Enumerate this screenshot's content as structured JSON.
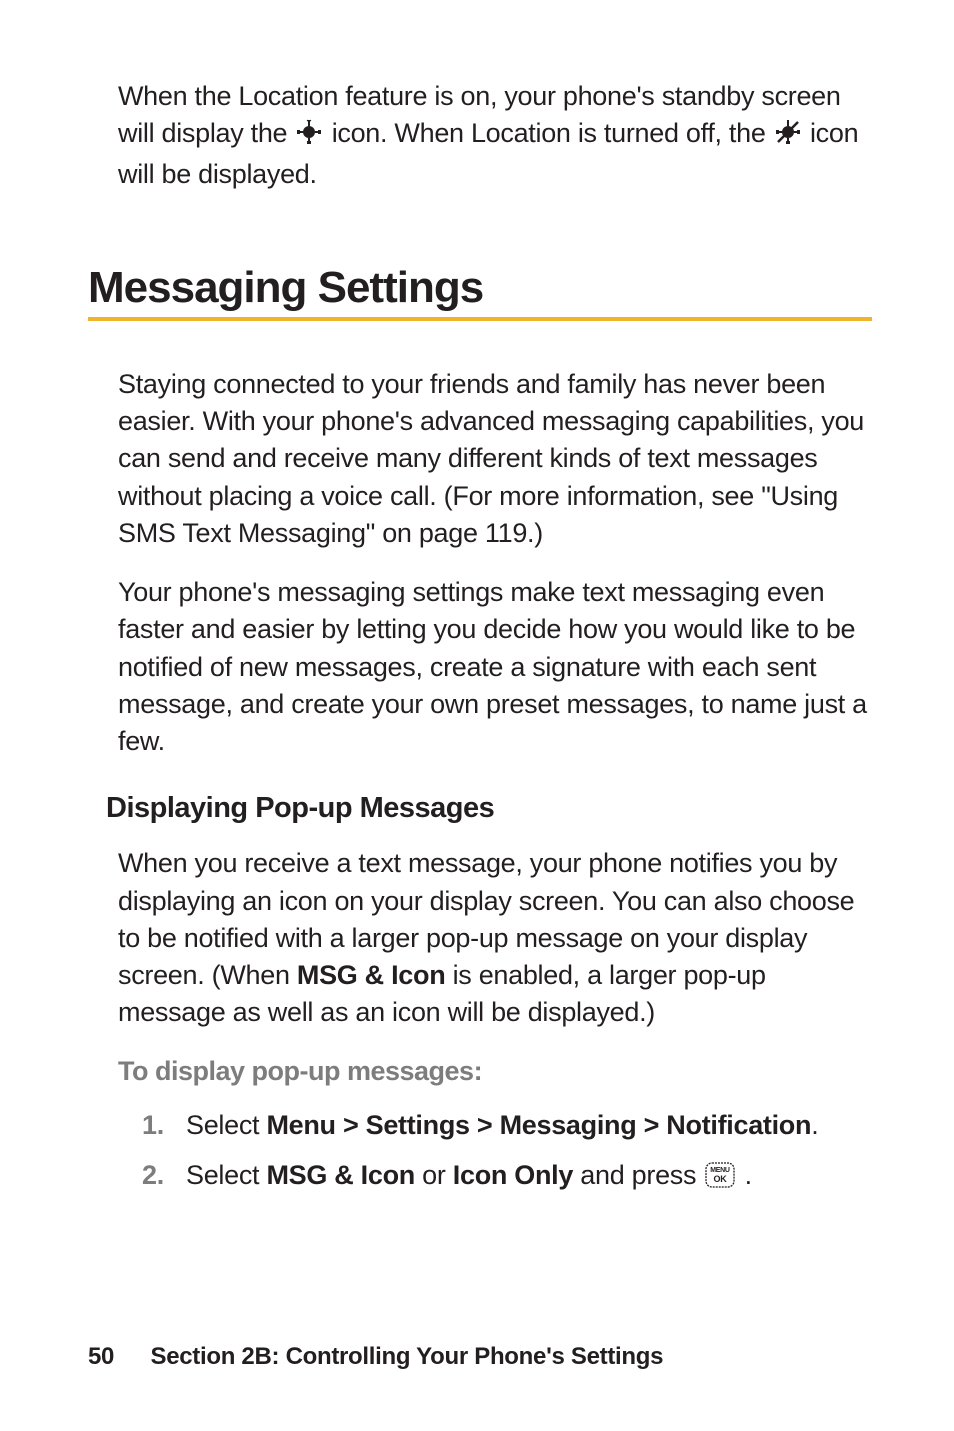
{
  "intro": {
    "part1": "When the Location feature is on, your phone's standby screen will display the ",
    "part2": " icon. When Location is turned off, the ",
    "part3": " icon will be displayed."
  },
  "section_heading": "Messaging Settings",
  "para1": "Staying connected to your friends and family has never been easier. With your phone's advanced messaging capabilities, you can send and receive many different kinds of text messages without placing a voice call. (For more information, see \"Using SMS Text Messaging\" on page 119.)",
  "para2": "Your phone's messaging settings make text messaging even faster and easier by letting you decide how you would like to be notified of new messages, create a signature with each sent message, and create your own preset messages, to name just a few.",
  "sub1_heading": "Displaying Pop-up Messages",
  "sub1_para": {
    "t1": "When you receive a text message, your phone notifies you by displaying an icon on your display screen. You can also choose to be notified with a larger pop-up message on your display screen. (When ",
    "b1": "MSG & Icon",
    "t2": " is enabled, a larger pop-up message as well as an icon will be displayed.)"
  },
  "action_label": "To display pop-up messages:",
  "steps": {
    "s1": {
      "num": "1.",
      "t1": "Select ",
      "b1": "Menu > Settings > Messaging > Notification",
      "t2": "."
    },
    "s2": {
      "num": "2.",
      "t1": "Select ",
      "b1": "MSG & Icon",
      "t2": " or ",
      "b2": "Icon Only",
      "t3": " and press ",
      "t4": " ."
    }
  },
  "footer": {
    "page": "50",
    "label": "Section 2B: Controlling Your Phone's Settings"
  }
}
